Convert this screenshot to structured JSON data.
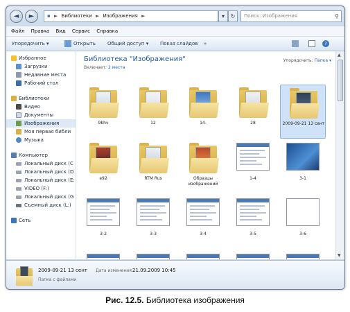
{
  "window": {
    "address_parts": [
      "Библиотеки",
      "Изображения"
    ],
    "search_placeholder": "Поиск: Изображения"
  },
  "menu": [
    "Файл",
    "Правка",
    "Вид",
    "Сервис",
    "Справка"
  ],
  "toolbar": {
    "organize": "Упорядочить ▾",
    "open": "Открыть",
    "share": "Общий доступ ▾",
    "slideshow": "Показ слайдов",
    "more": "»"
  },
  "sidebar": {
    "favorites": {
      "label": "Избранное",
      "items": [
        "Загрузки",
        "Недавние места",
        "Рабочий стол"
      ]
    },
    "libraries": {
      "label": "Библиотеки",
      "items": [
        "Видео",
        "Документы",
        "Изображения",
        "Моя первая библи",
        "Музыка"
      ]
    },
    "computer": {
      "label": "Компьютер",
      "items": [
        "Локальный диск (C",
        "Локальный диск (D",
        "Локальный диск (E:",
        "VIDEO (F:)",
        "Локальный диск (G",
        "Съемный диск (L:)"
      ]
    },
    "network": {
      "label": "Сеть"
    }
  },
  "library": {
    "title": "Библиотека \"Изображения\"",
    "includes_label": "Включает:",
    "includes_link": "2 места",
    "arrange_label": "Упорядочить:",
    "arrange_value": "Папка ▾"
  },
  "items": [
    {
      "label": "9bhv",
      "kind": "folder"
    },
    {
      "label": "12",
      "kind": "folder"
    },
    {
      "label": "14-",
      "kind": "folder"
    },
    {
      "label": "28",
      "kind": "folder"
    },
    {
      "label": "2009-09-21 13 сент",
      "kind": "folder",
      "selected": true
    },
    {
      "label": "e92",
      "kind": "folder"
    },
    {
      "label": "RTM Rus",
      "kind": "folder"
    },
    {
      "label": "Образцы изображений",
      "kind": "folder"
    },
    {
      "label": "1-4",
      "kind": "image"
    },
    {
      "label": "3-1",
      "kind": "image"
    },
    {
      "label": "3-2",
      "kind": "image"
    },
    {
      "label": "3-3",
      "kind": "image"
    },
    {
      "label": "3-4",
      "kind": "image"
    },
    {
      "label": "3-5",
      "kind": "image"
    },
    {
      "label": "3-6",
      "kind": "image"
    },
    {
      "label": "",
      "kind": "image"
    },
    {
      "label": "",
      "kind": "image"
    },
    {
      "label": "",
      "kind": "image"
    },
    {
      "label": "",
      "kind": "image"
    },
    {
      "label": "",
      "kind": "image"
    }
  ],
  "details": {
    "name": "2009-09-21 13 сент",
    "modified_label": "Дата изменения:",
    "modified_value": "21.09.2009 10:45",
    "type": "Папка с файлами"
  },
  "caption": {
    "bold": "Рис. 12.5.",
    "text": " Библиотека изображения"
  }
}
